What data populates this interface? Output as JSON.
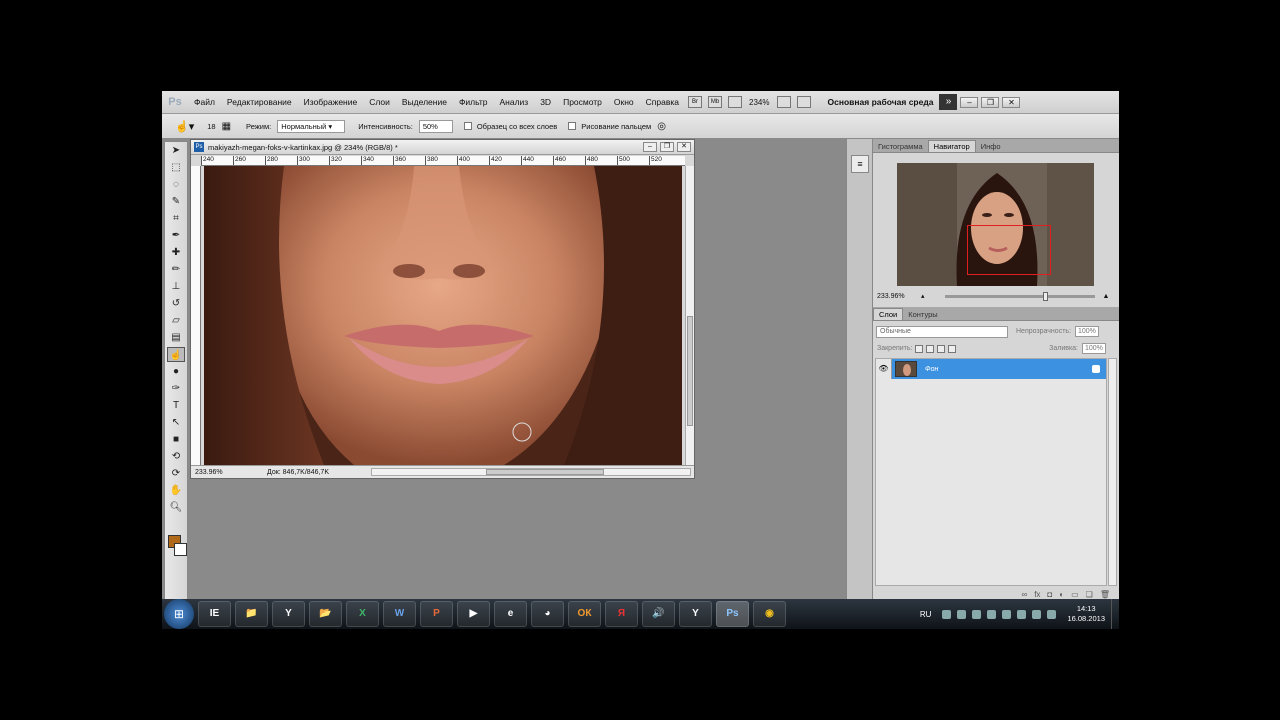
{
  "app": {
    "logo": "Ps"
  },
  "menu": [
    "Файл",
    "Редактирование",
    "Изображение",
    "Слои",
    "Выделение",
    "Фильтр",
    "Анализ",
    "3D",
    "Просмотр",
    "Окно",
    "Справка"
  ],
  "menubar": {
    "zoom": "234%",
    "workspace": "Основная рабочая среда",
    "icons": {
      "bridge": "Br",
      "mini": "Mb"
    }
  },
  "options": {
    "brush_size": "18",
    "mode_label": "Режим:",
    "mode_value": "Нормальный",
    "intensity_label": "Интенсивность:",
    "intensity_value": "50%",
    "sample_all_label": "Образец со всех слоев",
    "finger_label": "Рисование пальцем"
  },
  "document": {
    "title": "makiyazh-megan-foks-v-kartinkax.jpg @ 234% (RGB/8) *",
    "ruler_ticks": [
      "240",
      "260",
      "280",
      "300",
      "320",
      "340",
      "360",
      "380",
      "400",
      "420",
      "440",
      "460",
      "480",
      "500",
      "520"
    ],
    "zoom": "233.96%",
    "doc_info": "Док: 846,7K/846,7K"
  },
  "panels": {
    "tabs": [
      "Гистограмма",
      "Навигатор",
      "Инфо"
    ],
    "navigator_zoom": "233.96%",
    "navigator_slider": 0.68,
    "layers_tabs": [
      "Слои",
      "Контуры"
    ],
    "blend_mode": "Обычные",
    "opacity_label": "Непрозрачность:",
    "opacity_value": "100%",
    "lock_label": "Закрепить:",
    "fill_label": "Заливка:",
    "fill_value": "100%",
    "layer_name": "Фон"
  },
  "taskbar": {
    "apps": [
      "IE",
      "📁",
      "Y",
      "📂",
      "X",
      "W",
      "P",
      "▶",
      "e",
      "◕",
      "ОК",
      "Я",
      "🔊",
      "Y",
      "Ps",
      "◉"
    ],
    "lang": "RU",
    "time": "14:13",
    "date": "16.08.2013"
  },
  "colors": {
    "foreground": "#b06a1a",
    "background": "#ffffff",
    "layer_selected": "#3c92e0"
  }
}
